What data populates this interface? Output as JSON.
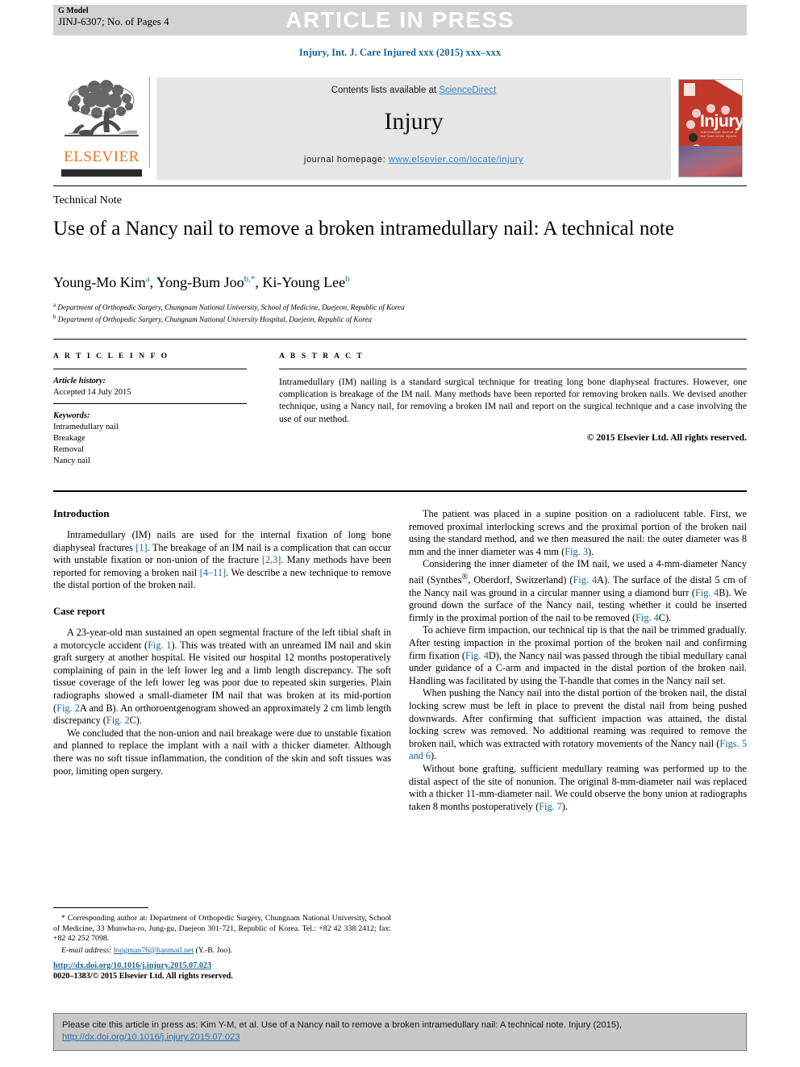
{
  "header": {
    "g_model_label": "G Model",
    "article_id": "JINJ-6307; No. of Pages 4",
    "banner": "ARTICLE IN PRESS",
    "journal_citation": "Injury, Int. J. Care Injured xxx (2015) xxx–xxx"
  },
  "masthead": {
    "contents_prefix": "Contents lists available at ",
    "contents_link": "ScienceDirect",
    "journal_name": "Injury",
    "homepage_prefix": "journal homepage: ",
    "homepage_link": "www.elsevier.com/locate/injury",
    "publisher_logo_text": "ELSEVIER",
    "publisher_logo_icon": "elsevier-tree-icon",
    "cover_title": "Injury",
    "cover_subtitle": "International Journal of the Care of the Injured"
  },
  "article": {
    "type_label": "Technical Note",
    "title": "Use of a Nancy nail to remove a broken intramedullary nail: A technical note",
    "authors_html": "Young-Mo Kim<sup>a</sup>, Yong-Bum Joo<sup>b,*</sup>, Ki-Young Lee<sup>b</sup>",
    "affiliation_a": "Department of Orthopedic Surgery, Chungnam National University, School of Medicine, Daejeon, Republic of Korea",
    "affiliation_b": "Department of Orthopedic Surgery, Chungnam National University Hospital, Daejeon, Republic of Korea"
  },
  "info": {
    "heading": "A R T I C L E   I N F O",
    "history_label": "Article history:",
    "history_value": "Accepted 14 July 2015",
    "keywords_label": "Keywords:",
    "keywords": [
      "Intramedullary nail",
      "Breakage",
      "Removal",
      "Nancy nail"
    ]
  },
  "abstract": {
    "heading": "A B S T R A C T",
    "text": "Intramedullary (IM) nailing is a standard surgical technique for treating long bone diaphyseal fractures. However, one complication is breakage of the IM nail. Many methods have been reported for removing broken nails. We devised another technique, using a Nancy nail, for removing a broken IM nail and report on the surgical technique and a case involving the use of our method.",
    "copyright": "© 2015 Elsevier Ltd. All rights reserved."
  },
  "body": {
    "introduction_heading": "Introduction",
    "introduction_p1_a": "Intramedullary (IM) nails are used for the internal fixation of long bone diaphyseal fractures ",
    "introduction_ref1": "[1]",
    "introduction_p1_b": ". The breakage of an IM nail is a complication that can occur with unstable fixation or non-union of the fracture ",
    "introduction_ref2": "[2,3]",
    "introduction_p1_c": ". Many methods have been reported for removing a broken nail ",
    "introduction_ref3": "[4–11]",
    "introduction_p1_d": ". We describe a new technique to remove the distal portion of the broken nail.",
    "case_heading": "Case report",
    "case_p1_a": "A 23-year-old man sustained an open segmental fracture of the left tibial shaft in a motorcycle accident (",
    "case_fig1": "Fig. 1",
    "case_p1_b": "). This was treated with an unreamed IM nail and skin graft surgery at another hospital. He visited our hospital 12 months postoperatively complaining of pain in the left lower leg and a limb length discrepancy. The soft tissue coverage of the left lower leg was poor due to repeated skin surgeries. Plain radiographs showed a small-diameter IM nail that was broken at its mid-portion (",
    "case_fig2ab": "Fig. 2",
    "case_p1_c": "A and B). An orthoroentgenogram showed an approximately 2 cm limb length discrepancy (",
    "case_fig2c": "Fig. 2",
    "case_p1_d": "C).",
    "case_p2": "We concluded that the non-union and nail breakage were due to unstable fixation and planned to replace the implant with a nail with a thicker diameter. Although there was no soft tissue inflammation, the condition of the skin and soft tissues was poor, limiting open surgery.",
    "right_p1_a": "The patient was placed in a supine position on a radiolucent table. First, we removed proximal interlocking screws and the proximal portion of the broken nail using the standard method, and we then measured the nail: the outer diameter was 8 mm and the inner diameter was 4 mm (",
    "right_fig3": "Fig. 3",
    "right_p1_b": ").",
    "right_p2_a": "Considering the inner diameter of the IM nail, we used a 4-mm-diameter Nancy nail (Synthes",
    "right_p2_b": ", Oberdorf, Switzerland) (",
    "right_fig4a": "Fig. 4",
    "right_p2_c": "A). The surface of the distal 5 cm of the Nancy nail was ground in a circular manner using a diamond burr (",
    "right_fig4b": "Fig. 4",
    "right_p2_d": "B). We ground down the surface of the Nancy nail, testing whether it could be inserted firmly in the proximal portion of the nail to be removed (",
    "right_fig4c": "Fig. 4",
    "right_p2_e": "C).",
    "right_p3_a": "To achieve firm impaction, our technical tip is that the nail be trimmed gradually. After testing impaction in the proximal portion of the broken nail and confirming firm fixation (",
    "right_fig4d": "Fig. 4",
    "right_p3_b": "D), the Nancy nail was passed through the tibial medullary canal under guidance of a C-arm and impacted in the distal portion of the broken nail. Handling was facilitated by using the T-handle that comes in the Nancy nail set.",
    "right_p4_a": "When pushing the Nancy nail into the distal portion of the broken nail, the distal locking screw must be left in place to prevent the distal nail from being pushed downwards. After confirming that sufficient impaction was attained, the distal locking screw was removed. No additional reaming was required to remove the broken nail, which was extracted with rotatory movements of the Nancy nail (",
    "right_fig56": "Figs. 5 and 6",
    "right_p4_b": ").",
    "right_p5_a": "Without bone grafting, sufficient medullary reaming was performed up to the distal aspect of the site of nonunion. The original 8-mm-diameter nail was replaced with a thicker 11-mm-diameter nail. We could observe the bony union at radiographs taken 8 months postoperatively (",
    "right_fig7": "Fig. 7",
    "right_p5_b": ")."
  },
  "footnote": {
    "corresponding": "* Corresponding author at: Department of Orthopedic Surgery, Chungnam National University, School of Medicine, 33 Munwha-ro, Jung-gu, Daejeon 301-721, Republic of Korea. Tel.: +82 42 338 2412; fax: +82 42 252 7098.",
    "email_label": "E-mail address:",
    "email_value": "longman76@hanmail.net",
    "email_owner": "(Y.-B. Joo).",
    "doi": "http://dx.doi.org/10.1016/j.injury.2015.07.023",
    "issn_line": "0020–1383/© 2015 Elsevier Ltd. All rights reserved."
  },
  "cite_box": {
    "text_a": "Please cite this article in press as: Kim Y-M, et al. Use of a Nancy nail to remove a broken intramedullary nail: A technical note. Injury (2015), ",
    "link": "http://dx.doi.org/10.1016/j.injury.2015.07.023"
  },
  "colors": {
    "link_blue": "#1a6496",
    "banner_gray": "#d2d2d2",
    "masthead_gray": "#e6e6e6",
    "elsevier_orange": "#e87722",
    "cover_red": "#c0392b",
    "cite_box_gray": "#c8c8c8"
  }
}
